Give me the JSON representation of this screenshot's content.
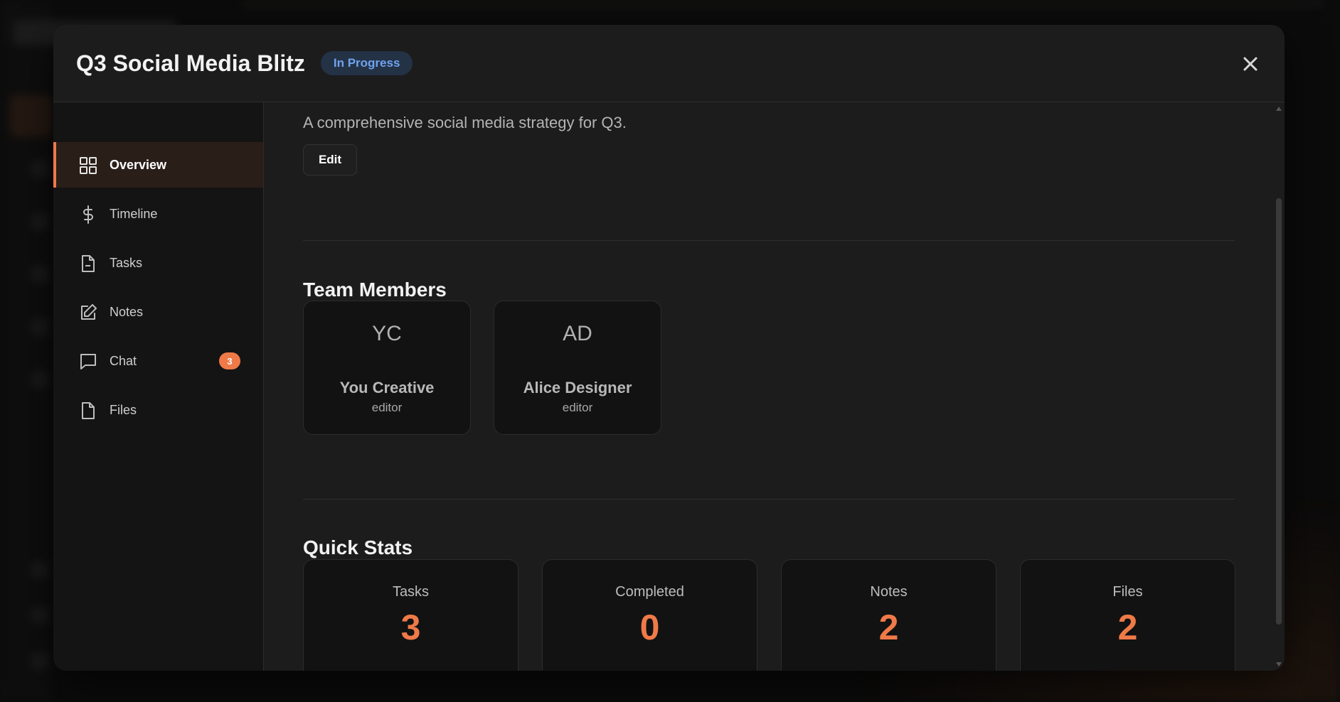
{
  "modal": {
    "title": "Q3 Social Media Blitz",
    "status": "In Progress",
    "close_icon": "close-icon"
  },
  "sidebar": {
    "items": [
      {
        "label": "Overview",
        "icon": "grid-icon",
        "active": true
      },
      {
        "label": "Timeline",
        "icon": "dollar-icon"
      },
      {
        "label": "Tasks",
        "icon": "file-icon"
      },
      {
        "label": "Notes",
        "icon": "edit-icon"
      },
      {
        "label": "Chat",
        "icon": "chat-icon",
        "badge": "3"
      },
      {
        "label": "Files",
        "icon": "file-icon"
      }
    ]
  },
  "overview": {
    "description": "A comprehensive social media strategy for Q3.",
    "edit_label": "Edit"
  },
  "team": {
    "title": "Team Members",
    "members": [
      {
        "initials": "YC",
        "name": "You Creative",
        "role": "editor"
      },
      {
        "initials": "AD",
        "name": "Alice Designer",
        "role": "editor"
      }
    ]
  },
  "stats": {
    "title": "Quick Stats",
    "items": [
      {
        "label": "Tasks",
        "value": "3"
      },
      {
        "label": "Completed",
        "value": "0"
      },
      {
        "label": "Notes",
        "value": "2"
      },
      {
        "label": "Files",
        "value": "2"
      }
    ]
  },
  "colors": {
    "accent": "#ef7a48",
    "status_bg": "#243246",
    "status_text": "#6fa3ef"
  }
}
